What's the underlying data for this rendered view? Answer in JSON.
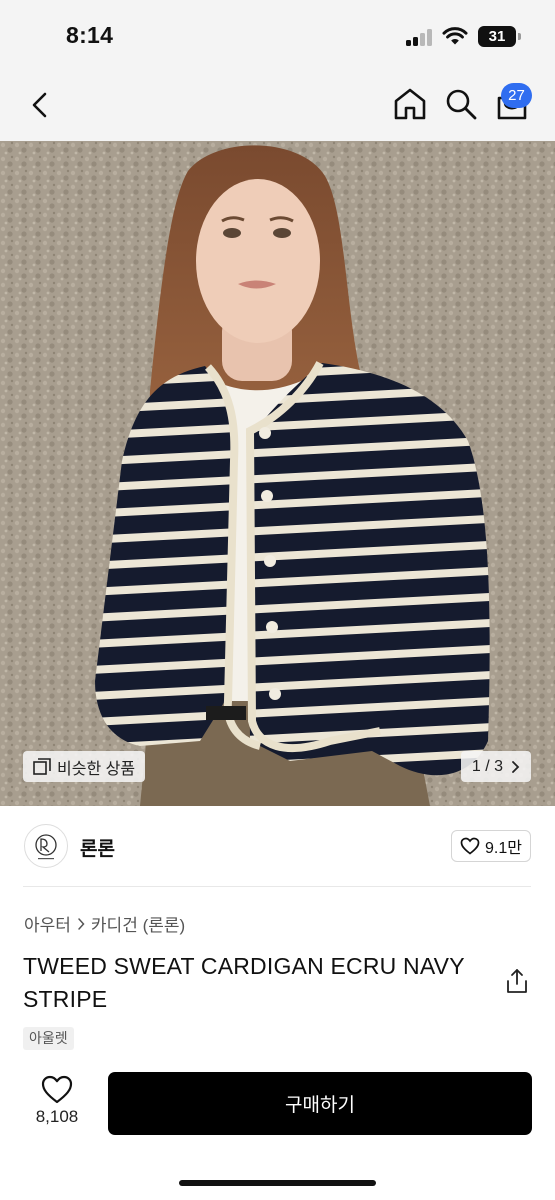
{
  "status_bar": {
    "time": "8:14",
    "battery_level": "31",
    "icons": [
      "cellular-signal-icon",
      "wifi-icon",
      "battery-icon"
    ]
  },
  "nav": {
    "icons": [
      "back-chevron-icon",
      "home-icon",
      "search-icon",
      "cart-icon"
    ],
    "cart_badge": "27",
    "accent_color": "#2f6df0"
  },
  "hero": {
    "similar_products_label": "비슷한 상품",
    "image_counter": "1 / 3",
    "current_image": 1,
    "total_images": 3
  },
  "brand": {
    "name": "론론",
    "likes": "9.1만"
  },
  "breadcrumb": {
    "category": "아우터",
    "subcategory": "카디건 (론론)"
  },
  "product": {
    "title": "TWEED SWEAT CARDIGAN ECRU NAVY STRIPE",
    "tag": "아울렛"
  },
  "bottom_bar": {
    "wish_count": "8,108",
    "buy_label": "구매하기",
    "buy_color": "#000000"
  }
}
